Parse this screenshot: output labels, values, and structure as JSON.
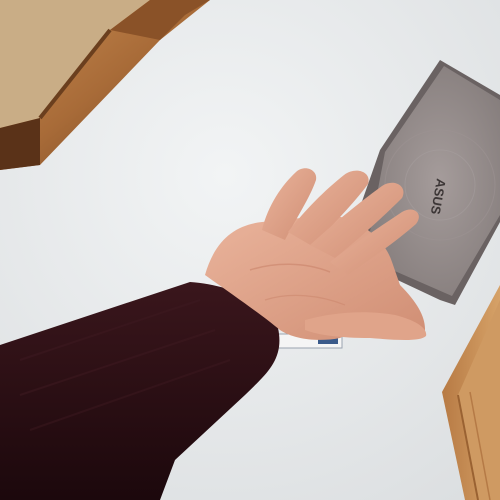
{
  "scene": {
    "description_labels": {
      "laptop_logo": "ASUS"
    },
    "colors": {
      "wall": "#e9ebec",
      "wall_shadow": "#dfe2e4",
      "wood_dark": "#6b3f1e",
      "wood_mid": "#a86b38",
      "wood_light": "#c98c52",
      "fabric": "#c9ad86",
      "laptop_body": "#8d8584",
      "laptop_edge": "#6a6262",
      "skin": "#e2a58c",
      "skin_shadow": "#c9836a",
      "sleeve": "#2a0f14"
    }
  }
}
